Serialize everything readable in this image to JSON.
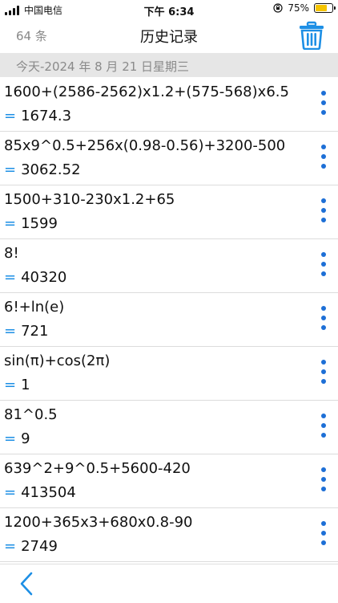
{
  "status_bar": {
    "carrier": "中国电信",
    "time": "下午 6:34",
    "battery_text": "75%",
    "battery_level": 0.75
  },
  "nav": {
    "count_label": "64 条",
    "title": "历史记录",
    "trash_icon": "trash-icon"
  },
  "date_header": "今天-2024 年 8 月 21 日星期三",
  "equals_symbol": "=",
  "history": [
    {
      "expression": "1600+(2586-2562)x1.2+(575-568)x6.5",
      "result": "1674.3"
    },
    {
      "expression": "85x9^0.5+256x(0.98-0.56)+3200-500",
      "result": "3062.52"
    },
    {
      "expression": "1500+310-230x1.2+65",
      "result": "1599"
    },
    {
      "expression": "8!",
      "result": "40320"
    },
    {
      "expression": "6!+ln(e)",
      "result": "721"
    },
    {
      "expression": "sin(π)+cos(2π)",
      "result": "1"
    },
    {
      "expression": "81^0.5",
      "result": "9"
    },
    {
      "expression": "639^2+9^0.5+5600-420",
      "result": "413504"
    },
    {
      "expression": "1200+365x3+680x0.8-90",
      "result": "2749"
    }
  ],
  "colors": {
    "accent": "#1d8fe5",
    "menu_dots": "#1d6fd6",
    "header_bg": "#e6e6e6",
    "battery": "#f5c400"
  },
  "bottom_bar": {
    "back_icon": "chevron-left-icon"
  }
}
